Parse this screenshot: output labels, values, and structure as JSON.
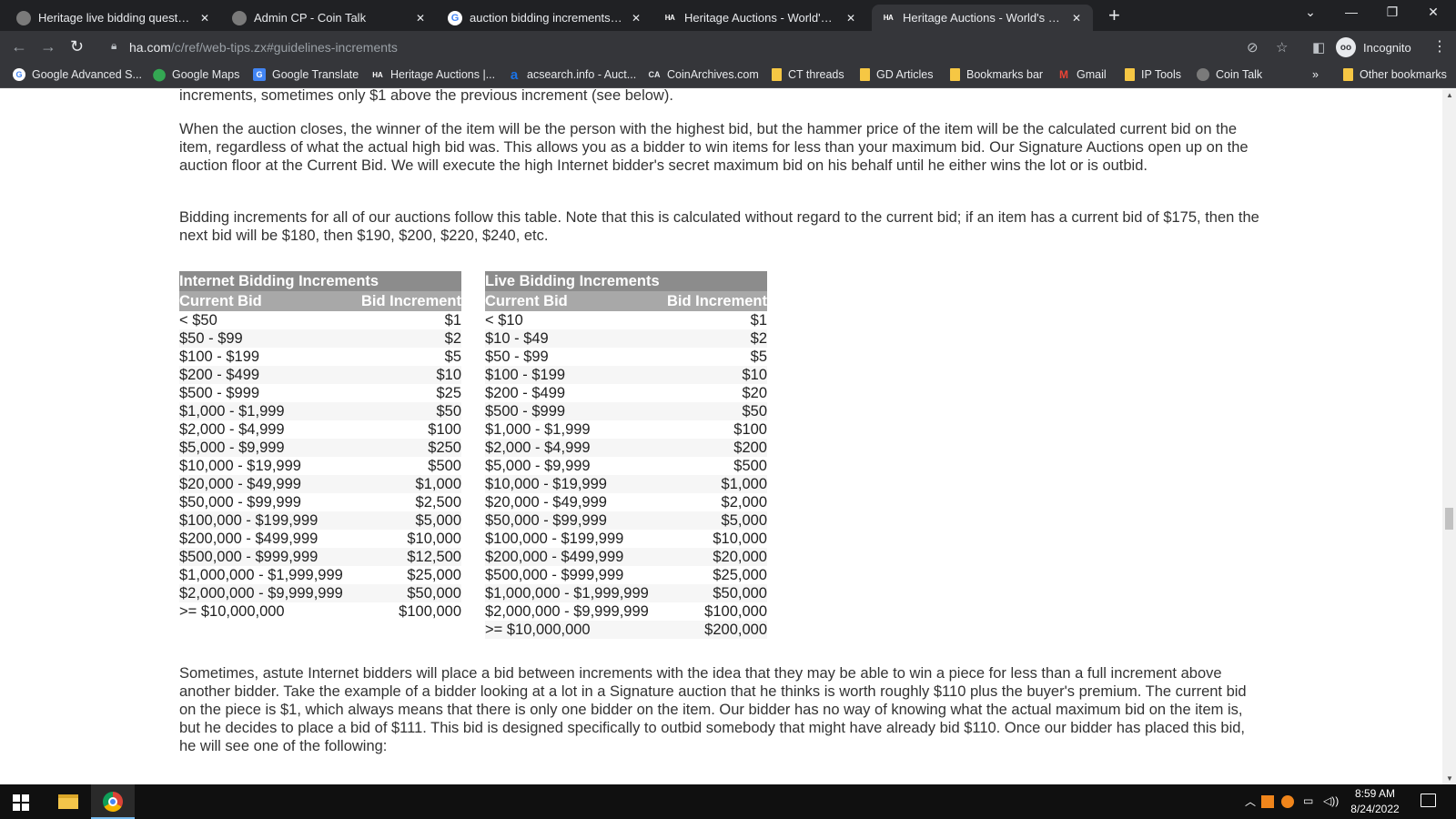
{
  "browser": {
    "tabs": [
      {
        "title": "Heritage live bidding question | C",
        "icon": "coin-talk-icon"
      },
      {
        "title": "Admin CP - Coin Talk",
        "icon": "coin-talk-icon"
      },
      {
        "title": "auction bidding increments \"Her",
        "icon": "google-icon"
      },
      {
        "title": "Heritage Auctions - World's Large",
        "icon": "heritage-auctions-icon"
      },
      {
        "title": "Heritage Auctions - World's Large",
        "icon": "heritage-auctions-icon",
        "active": true
      }
    ],
    "url_host": "ha.com",
    "url_path": "/c/ref/web-tips.zx#guidelines-increments",
    "profile_label": "Incognito",
    "bookmarks": [
      "Google Advanced S...",
      "Google Maps",
      "Google Translate",
      "Heritage Auctions |...",
      "acsearch.info - Auct...",
      "CoinArchives.com",
      "CT threads",
      "GD Articles",
      "Bookmarks bar",
      "Gmail",
      "IP Tools",
      "Coin Talk",
      "Other bookmarks"
    ],
    "bookmarks_overflow": "»"
  },
  "page": {
    "para_partial": "increments, sometimes only $1 above the previous increment (see below).",
    "para_closes": "When the auction closes, the winner of the item will be the person with the highest bid, but the hammer price of the item will be the calculated current bid on the item, regardless of what the actual high bid was. This allows you as a bidder to win items for less than your maximum bid. Our Signature Auctions open up on the auction floor at the Current Bid. We will execute the high Internet bidder's secret maximum bid on his behalf until he either wins the lot or is outbid.",
    "para_increments": "Bidding increments for all of our auctions follow this table. Note that this is calculated without regard to the current bid; if an item has a current bid of $175, then the next bid will be $180, then $190, $200, $220, $240, etc.",
    "para_astute": "Sometimes, astute Internet bidders will place a bid between increments with the idea that they may be able to win a piece for less than a full increment above another bidder. Take the example of a bidder looking at a lot in a Signature auction that he thinks is worth roughly $110 plus the buyer's premium. The current bid on the piece is $1, which always means that there is only one bidder on the item. Our bidder has no way of knowing what the actual maximum bid on the item is, but he decides to place a bid of $111. This bid is designed specifically to outbid somebody that might have already bid $110. Once our bidder has placed this bid, he will see one of the following:",
    "internet_table": {
      "title": "Internet Bidding Increments",
      "col_current": "Current Bid",
      "col_increment": "Bid Increment",
      "rows": [
        [
          "< $50",
          "$1"
        ],
        [
          "$50 - $99",
          "$2"
        ],
        [
          "$100 - $199",
          "$5"
        ],
        [
          "$200 - $499",
          "$10"
        ],
        [
          "$500 - $999",
          "$25"
        ],
        [
          "$1,000 - $1,999",
          "$50"
        ],
        [
          "$2,000 - $4,999",
          "$100"
        ],
        [
          "$5,000 - $9,999",
          "$250"
        ],
        [
          "$10,000 - $19,999",
          "$500"
        ],
        [
          "$20,000 - $49,999",
          "$1,000"
        ],
        [
          "$50,000 - $99,999",
          "$2,500"
        ],
        [
          "$100,000 - $199,999",
          "$5,000"
        ],
        [
          "$200,000 - $499,999",
          "$10,000"
        ],
        [
          "$500,000 - $999,999",
          "$12,500"
        ],
        [
          "$1,000,000 - $1,999,999",
          "$25,000"
        ],
        [
          "$2,000,000 - $9,999,999",
          "$50,000"
        ],
        [
          ">= $10,000,000",
          "$100,000"
        ]
      ]
    },
    "live_table": {
      "title": "Live Bidding Increments",
      "col_current": "Current Bid",
      "col_increment": "Bid Increment",
      "rows": [
        [
          "< $10",
          "$1"
        ],
        [
          "$10 - $49",
          "$2"
        ],
        [
          "$50 - $99",
          "$5"
        ],
        [
          "$100 - $199",
          "$10"
        ],
        [
          "$200 - $499",
          "$20"
        ],
        [
          "$500 - $999",
          "$50"
        ],
        [
          "$1,000 - $1,999",
          "$100"
        ],
        [
          "$2,000 - $4,999",
          "$200"
        ],
        [
          "$5,000 - $9,999",
          "$500"
        ],
        [
          "$10,000 - $19,999",
          "$1,000"
        ],
        [
          "$20,000 - $49,999",
          "$2,000"
        ],
        [
          "$50,000 - $99,999",
          "$5,000"
        ],
        [
          "$100,000 - $199,999",
          "$10,000"
        ],
        [
          "$200,000 - $499,999",
          "$20,000"
        ],
        [
          "$500,000 - $999,999",
          "$25,000"
        ],
        [
          "$1,000,000 - $1,999,999",
          "$50,000"
        ],
        [
          "$2,000,000 - $9,999,999",
          "$100,000"
        ],
        [
          ">= $10,000,000",
          "$200,000"
        ]
      ]
    }
  },
  "taskbar": {
    "time": "8:59 AM",
    "date": "8/24/2022"
  }
}
